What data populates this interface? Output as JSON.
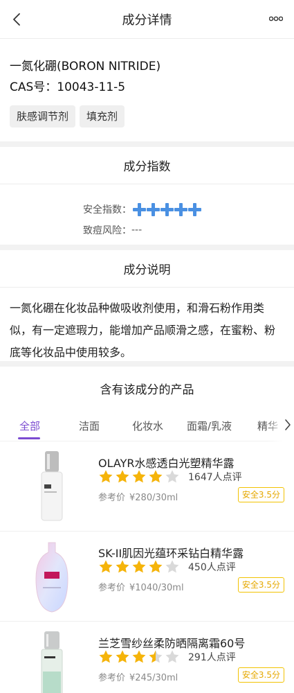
{
  "header": {
    "title": "成分详情"
  },
  "ingredient": {
    "name": "一氮化硼(BORON NITRIDE)",
    "cas_label": "CAS号：",
    "cas_value": "10043-11-5",
    "tags": [
      "肤感调节剂",
      "填充剂"
    ]
  },
  "index": {
    "title": "成分指数",
    "safety_label": "安全指数：",
    "safety_level": 5,
    "acne_label": "致痘风险：",
    "acne_value": "---"
  },
  "description": {
    "title": "成分说明",
    "lines": [
      "一氮化硼在化妆品种做吸收剂使用，和滑石粉作用类",
      "似，有一定遮瑕力，能增加产品顺滑之感，在蜜粉、粉",
      "底等化妆品中使用较多。"
    ]
  },
  "products": {
    "title": "含有该成分的产品",
    "tabs": [
      "全部",
      "洁面",
      "化妆水",
      "面霜/乳液",
      "精华"
    ],
    "active_tab": 0,
    "price_label": "参考价",
    "items": [
      {
        "name": "OLAYR水感透白光塑精华露",
        "rating": 4,
        "reviews": "1647人点评",
        "price": "¥280/30ml",
        "safety": "安全3.5分"
      },
      {
        "name": "SK-II肌因光蕴环采钻白精华露",
        "rating": 4,
        "reviews": "450人点评",
        "price": "¥1040/30ml",
        "safety": "安全3.5分"
      },
      {
        "name": "兰芝雪纱丝柔防晒隔离霜60号",
        "rating": 3.5,
        "reviews": "291人点评",
        "price": "¥245/30ml",
        "safety": "安全3.5分"
      }
    ]
  },
  "colors": {
    "accent": "#7b4bd1",
    "safety_cross": "#4a90e2",
    "star": "#f5b40a",
    "star_empty": "#d9d9d9",
    "badge": "#e6a800"
  }
}
